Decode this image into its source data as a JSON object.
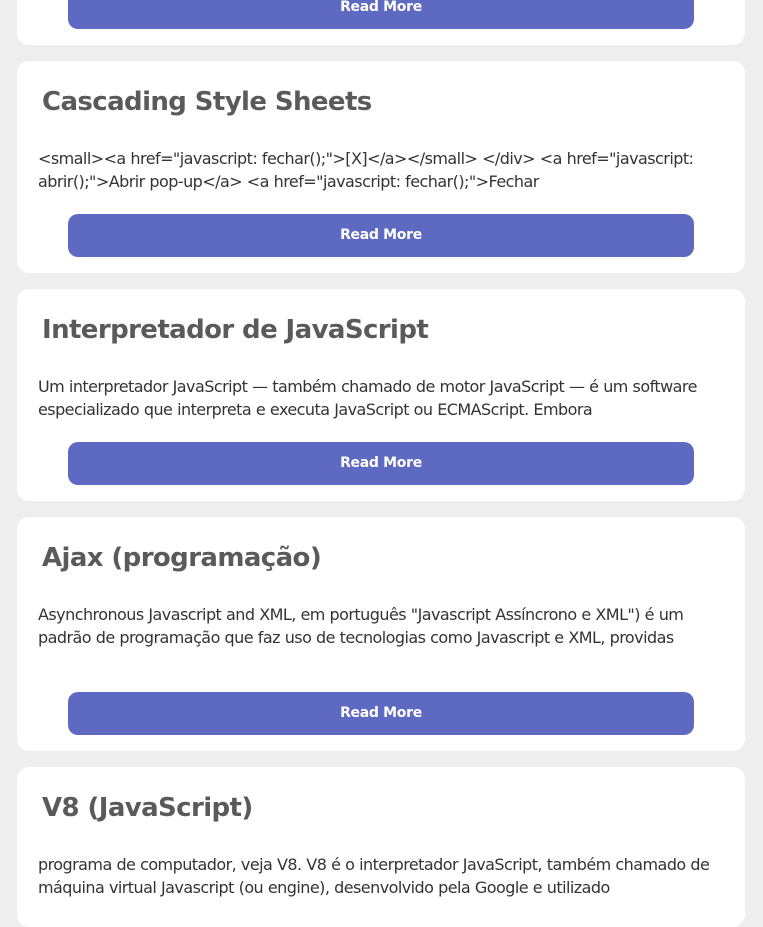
{
  "articles": [
    {
      "title": "",
      "excerpt": "",
      "button_label": "Read More"
    },
    {
      "title": "Cascading Style Sheets",
      "excerpt": "<small><a href=\"javascript: fechar();\">[X]</a></small> </div> <a href=\"javascript: abrir();\">Abrir pop-up</a> <a href=\"javascript: fechar();\">Fechar",
      "button_label": "Read More"
    },
    {
      "title": "Interpretador de JavaScript",
      "excerpt": "Um interpretador JavaScript — também chamado de motor JavaScript — é um software especializado que interpreta e executa JavaScript ou ECMAScript. Embora",
      "button_label": "Read More"
    },
    {
      "title": "Ajax (programação)",
      "excerpt": "Asynchronous Javascript and XML, em português \"Javascript Assíncrono e XML\") é um padrão de programação que faz uso de tecnologias como Javascript e XML, providas",
      "button_label": "Read More"
    },
    {
      "title": "V8 (JavaScript)",
      "excerpt": "programa de computador, veja V8. V8 é o interpretador JavaScript, também chamado de máquina virtual Javascript (ou engine), desenvolvido pela Google e utilizado",
      "button_label": "Read More"
    }
  ]
}
